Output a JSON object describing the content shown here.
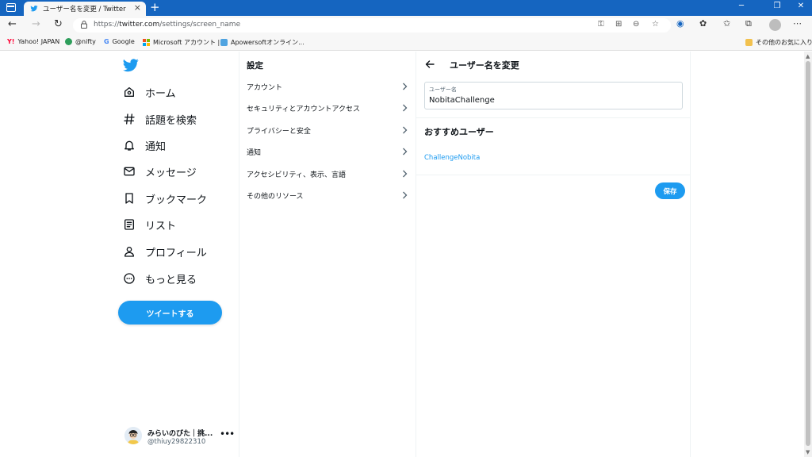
{
  "browser": {
    "tab_title": "ユーザー名を変更 / Twitter",
    "new_tab_symbol": "+",
    "url_prefix": "https://",
    "url_domain": "twitter.com",
    "url_path": "/settings/screen_name",
    "bookmarks": [
      {
        "label": "Yahoo! JAPAN",
        "icon": "yahoo-icon"
      },
      {
        "label": "@nifty",
        "icon": "nifty-icon"
      },
      {
        "label": "Google",
        "icon": "google-icon"
      },
      {
        "label": "Microsoft アカウント |...",
        "icon": "microsoft-icon"
      },
      {
        "label": "Apowersoftオンライン...",
        "icon": "apowersoft-icon"
      }
    ],
    "other_favorites": "その他のお気に入り"
  },
  "sidebar": {
    "items": [
      {
        "label": "ホーム",
        "icon": "home-icon"
      },
      {
        "label": "話題を検索",
        "icon": "hashtag-icon"
      },
      {
        "label": "通知",
        "icon": "bell-icon"
      },
      {
        "label": "メッセージ",
        "icon": "envelope-icon"
      },
      {
        "label": "ブックマーク",
        "icon": "bookmark-icon"
      },
      {
        "label": "リスト",
        "icon": "list-icon"
      },
      {
        "label": "プロフィール",
        "icon": "person-icon"
      },
      {
        "label": "もっと見る",
        "icon": "more-circle-icon"
      }
    ],
    "tweet_button": "ツイートする",
    "user": {
      "name": "みらいのびた｜挑...",
      "handle": "@thiuy29822310"
    }
  },
  "settings": {
    "title": "設定",
    "items": [
      "アカウント",
      "セキュリティとアカウントアクセス",
      "プライバシーと安全",
      "通知",
      "アクセシビリティ、表示、言語",
      "その他のリソース"
    ]
  },
  "username_panel": {
    "title": "ユーザー名を変更",
    "field_label": "ユーザー名",
    "field_value": "NobitaChallenge",
    "recommended_title": "おすすめユーザー",
    "recommended": [
      "ChallengeNobita"
    ],
    "save_button": "保存"
  },
  "colors": {
    "accent": "#1d9bf0",
    "browser_frame": "#1565c0"
  }
}
